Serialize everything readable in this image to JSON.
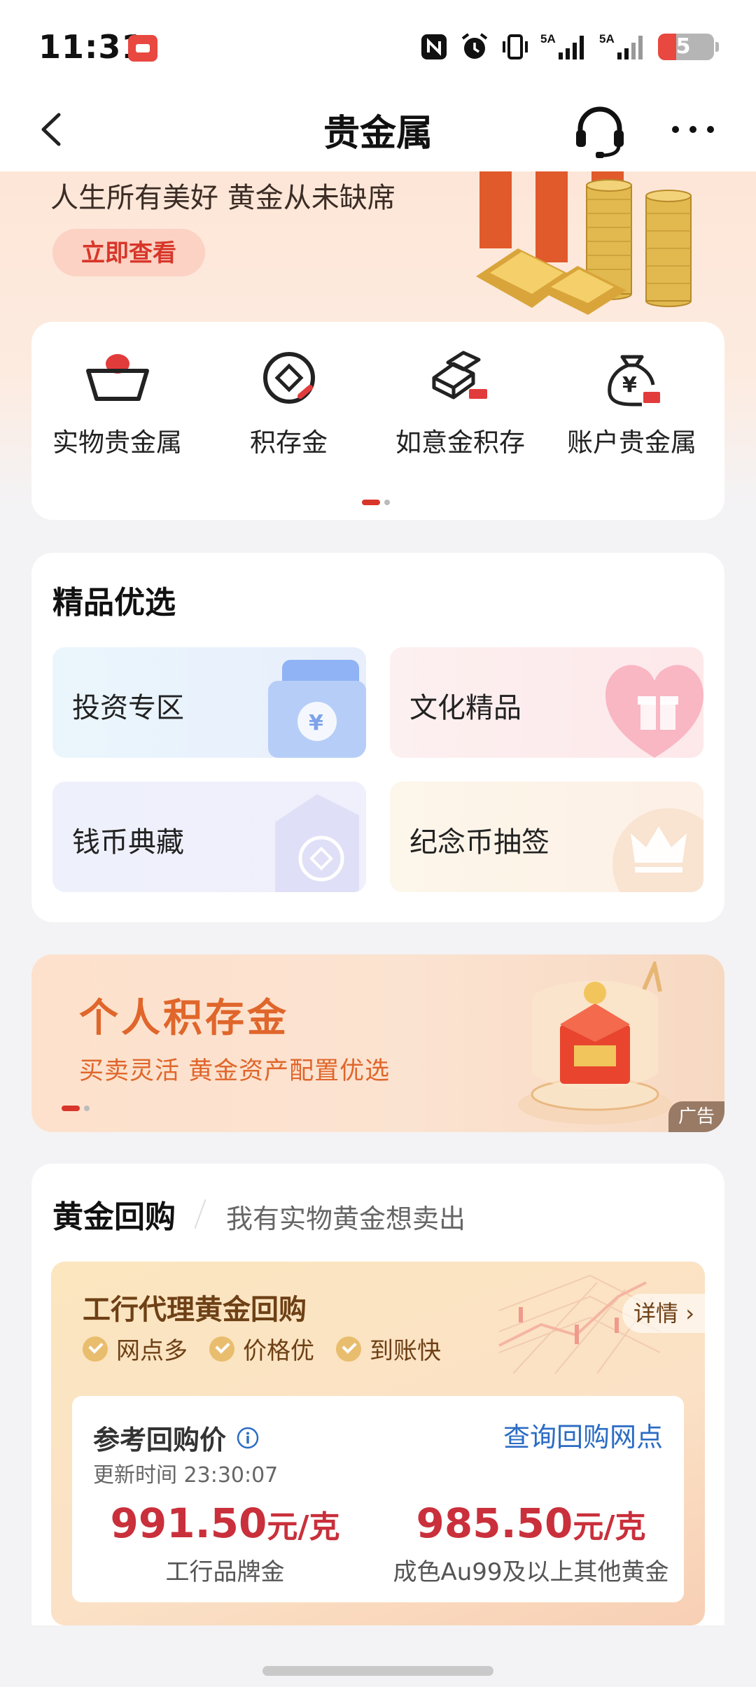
{
  "status_bar": {
    "time": "11:31",
    "signal_1_label": "5A",
    "signal_2_label": "5A",
    "battery_level": "5",
    "icons": [
      "app-badge-icon",
      "nfc-icon",
      "alarm-icon",
      "vibrate-icon",
      "signal-5a-icon",
      "signal-5a-icon",
      "battery-icon"
    ]
  },
  "nav": {
    "title": "贵金属",
    "icons": [
      "back-icon",
      "customer-service-icon",
      "more-icon"
    ]
  },
  "hero": {
    "slogan": "人生所有美好 黄金从未缺席",
    "button_label": "立即查看"
  },
  "quick_entries": {
    "items": [
      {
        "label": "实物贵金属",
        "icon": "gold-ingot-icon"
      },
      {
        "label": "积存金",
        "icon": "savings-gold-icon"
      },
      {
        "label": "如意金积存",
        "icon": "gold-bars-icon"
      },
      {
        "label": "账户贵金属",
        "icon": "money-bag-icon"
      }
    ],
    "page_count": 2,
    "active_page": 1
  },
  "featured": {
    "title": "精品优选",
    "tiles": [
      {
        "label": "投资专区",
        "icon": "money-bag-card-icon"
      },
      {
        "label": "文化精品",
        "icon": "gift-icon"
      },
      {
        "label": "钱币典藏",
        "icon": "coin-card-icon"
      },
      {
        "label": "纪念币抽签",
        "icon": "crown-icon"
      }
    ]
  },
  "ad_banner": {
    "title": "个人积存金",
    "subtitle": "买卖灵活   黄金资产配置优选",
    "tag": "广告",
    "page_count": 2,
    "active_page": 1
  },
  "gold_buyback": {
    "title": "黄金回购",
    "subtitle": "我有实物黄金想卖出",
    "panel_title": "工行代理黄金回购",
    "features": [
      "网点多",
      "价格优",
      "到账快"
    ],
    "detail_label": "详情",
    "price_card": {
      "title": "参考回购价",
      "query_link": "查询回购网点",
      "update_time": "更新时间 23:30:07",
      "prices": [
        {
          "value": "991.50",
          "unit": "元/克",
          "label": "工行品牌金"
        },
        {
          "value": "985.50",
          "unit": "元/克",
          "label": "成色Au99及以上其他黄金"
        }
      ]
    }
  },
  "colors": {
    "brand_red": "#d8362a",
    "price_red": "#c9303b",
    "link_blue": "#2b6cc4",
    "gold_brown": "#6e4016",
    "ad_orange": "#e0662b"
  }
}
